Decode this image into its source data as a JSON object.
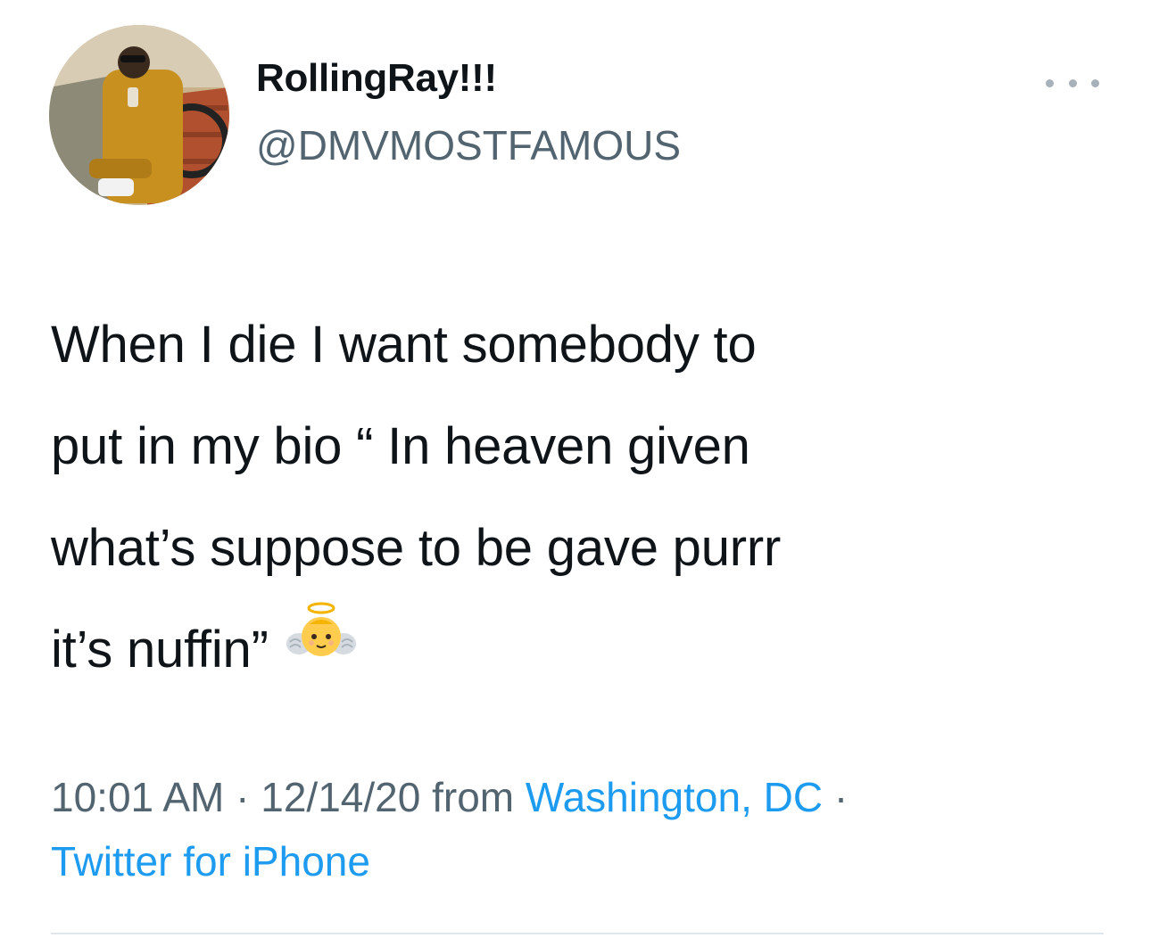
{
  "tweet": {
    "author": {
      "display_name": "RollingRay!!!",
      "handle": "@DMVMOSTFAMOUS"
    },
    "more_icon": "ellipsis-icon",
    "text_lines": [
      "When I die I want somebody to",
      "put in my bio “ In heaven given",
      "what’s suppose to be gave purrr",
      "it’s nuffin”"
    ],
    "emoji": "baby-angel-emoji",
    "meta": {
      "time": "10:01 AM",
      "separator": " · ",
      "date": "12/14/20",
      "from_label": " from ",
      "location": "Washington, DC",
      "trailing_separator": " ·",
      "source": "Twitter for iPhone"
    }
  },
  "colors": {
    "text": "#0f1419",
    "secondary": "#536471",
    "link": "#1d9bf0",
    "divider": "#e1e8ed"
  }
}
